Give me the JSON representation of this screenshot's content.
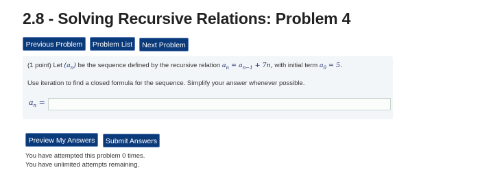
{
  "page": {
    "title": "2.8 - Solving Recursive Relations: Problem 4"
  },
  "nav": {
    "previous": "Previous Problem",
    "list": "Problem List",
    "next": "Next Problem"
  },
  "problem": {
    "points": "(1 point)",
    "intro": "Let",
    "sequence_math": "(a",
    "sequence_sub": "n",
    "sequence_close": ")",
    "middle": "be the sequence defined by the recursive relation",
    "relation_lhs": "a",
    "relation_lhs_sub": "n",
    "relation_eq": "=",
    "relation_rhs": "a",
    "relation_rhs_sub": "n−1",
    "relation_plus": "+ 7n,",
    "initial_text": "with initial term",
    "initial_var": "a",
    "initial_sub": "0",
    "initial_val": "= 5.",
    "instruction": "Use iteration to find a closed formula for the sequence. Simplify your answer whenever possible."
  },
  "answer": {
    "label_var": "a",
    "label_sub": "n",
    "label_eq": "=",
    "value": ""
  },
  "actions": {
    "preview": "Preview My Answers",
    "submit": "Submit Answers"
  },
  "status": {
    "attempted": "You have attempted this problem 0 times.",
    "remaining": "You have unlimited attempts remaining."
  },
  "colors": {
    "button_bg": "#0b3a7a",
    "problem_bg": "#f3f6f8"
  }
}
